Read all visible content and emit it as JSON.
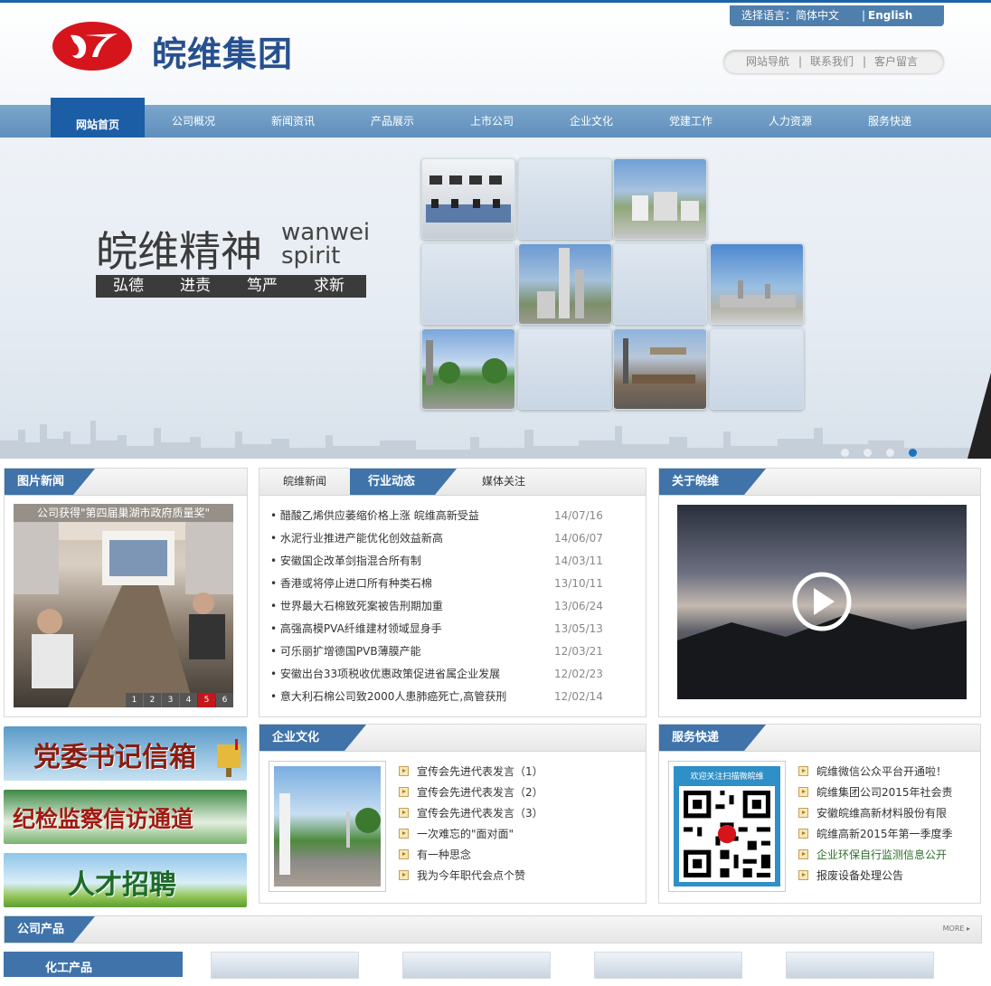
{
  "header": {
    "logo_text": "皖维集团",
    "lang_label": "选择语言：简体中文",
    "lang_sep": "|",
    "lang_english": "English",
    "quick_links": [
      "网站导航",
      "|",
      "联系我们",
      "|",
      "客户留言"
    ]
  },
  "nav": {
    "items": [
      "网站首页",
      "公司概况",
      "新闻资讯",
      "产品展示",
      "上市公司",
      "企业文化",
      "党建工作",
      "人力资源",
      "服务快递"
    ],
    "active_index": 0
  },
  "banner": {
    "title": "皖维精神",
    "en_line1": "wanwei",
    "en_line2": "spirit",
    "values": [
      "弘德",
      "进责",
      "笃严",
      "求新"
    ],
    "slides": 4,
    "active_slide": 4
  },
  "photo_news": {
    "title": "图片新闻",
    "caption": "公司获得\"第四届巢湖市政府质量奖\"",
    "pager": [
      "1",
      "2",
      "3",
      "4",
      "5",
      "6"
    ],
    "active_page": "5"
  },
  "news": {
    "tabs": [
      "皖维新闻",
      "行业动态",
      "媒体关注"
    ],
    "active_tab": "行业动态",
    "items": [
      {
        "title": "• 醋酸乙烯供应萎缩价格上涨 皖维高新受益",
        "date": "14/07/16"
      },
      {
        "title": "• 水泥行业推进产能优化创效益新高",
        "date": "14/06/07"
      },
      {
        "title": "• 安徽国企改革剑指混合所有制",
        "date": "14/03/11"
      },
      {
        "title": "• 香港或将停止进口所有种类石棉",
        "date": "13/10/11"
      },
      {
        "title": "• 世界最大石棉致死案被告刑期加重",
        "date": "13/06/24"
      },
      {
        "title": "• 高强高模PVA纤维建材领域显身手",
        "date": "13/05/13"
      },
      {
        "title": "• 可乐丽扩增德国PVB薄膜产能",
        "date": "12/03/21"
      },
      {
        "title": "• 安徽出台33项税收优惠政策促进省属企业发展",
        "date": "12/02/23"
      },
      {
        "title": "• 意大利石棉公司致2000人患肺癌死亡,高管获刑",
        "date": "12/02/14"
      }
    ]
  },
  "about": {
    "title": "关于皖维"
  },
  "side_banners": [
    "党委书记信箱",
    "纪检监察信访通道",
    "人才招聘"
  ],
  "culture": {
    "title": "企业文化",
    "items": [
      "宣传会先进代表发言（1）",
      "宣传会先进代表发言（2）",
      "宣传会先进代表发言（3）",
      "一次难忘的\"面对面\"",
      "有一种思念",
      "我为今年职代会点个赞"
    ]
  },
  "service": {
    "title": "服务快递",
    "qr_caption": "欢迎关注扫描微皖维",
    "items": [
      "皖维微信公众平台开通啦！",
      "皖维集团公司2015年社会责",
      "安徽皖维高新材料股份有限",
      "皖维高新2015年第一季度季",
      "企业环保自行监测信息公开",
      "报废设备处理公告"
    ]
  },
  "products": {
    "title": "公司产品",
    "more": "MORE ▸",
    "category": "化工产品"
  },
  "colors": {
    "brand_blue": "#1c5ea5",
    "nav_blue": "#6f9ac4",
    "tab_blue": "#3f73a9",
    "logo_red": "#d6141c"
  }
}
